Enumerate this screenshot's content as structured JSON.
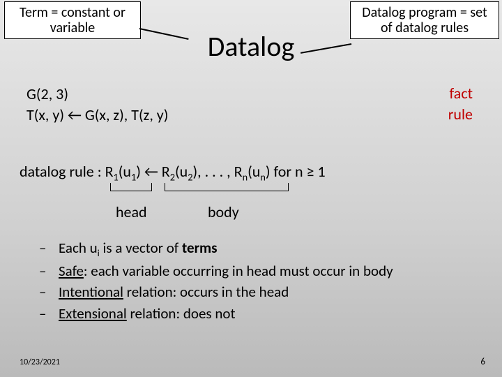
{
  "callouts": {
    "term": {
      "line1": "Term = constant or",
      "line2": "variable"
    },
    "program": {
      "line1": "Datalog program = set",
      "line2": "of datalog rules"
    }
  },
  "title": "Datalog",
  "example": {
    "fact": "G(2, 3)",
    "rule": "T(x, y) ← G(x, z), T(z, y)",
    "fact_label": "fact",
    "rule_label": "rule"
  },
  "ruleform": {
    "prefix": "datalog rule : R",
    "s1": "1",
    "open1": "(u",
    "s2": "1",
    "mid": ") ← R",
    "s3": "2",
    "open2": "(u",
    "s4": "2",
    "mid2": "), . . . , R",
    "s5": "n",
    "open3": "(u",
    "s6": "n",
    "tail": ") for n ≥ 1",
    "head_label": "head",
    "body_label": "body"
  },
  "bullets": {
    "b1_pre": "Each u",
    "b1_sub": "i",
    "b1_mid": " is a vector of ",
    "b1_bold": "terms",
    "b2_u": "Safe",
    "b2_rest": ": each variable occurring in head must occur in body",
    "b3_u": "Intentional",
    "b3_rest": " relation: occurs in the head",
    "b4_u": "Extensional",
    "b4_rest": " relation: does not"
  },
  "footer": {
    "date": "10/23/2021",
    "page": "6"
  },
  "dash": "–"
}
